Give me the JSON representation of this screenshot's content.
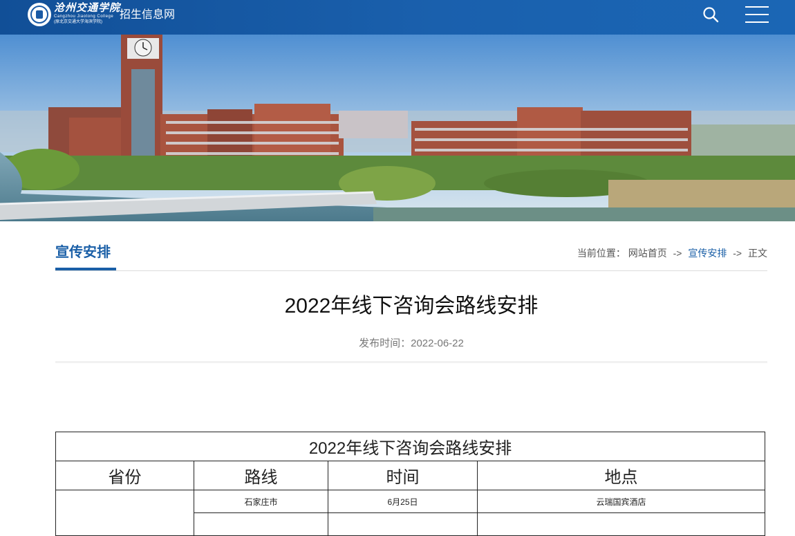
{
  "header": {
    "logo_cn": "沧州交通学院",
    "logo_en": "Cangzhou Jiaotong College",
    "logo_sub": "(原北京交通大学海滨学院)",
    "site_name": "招生信息网"
  },
  "section": {
    "title": "宣传安排"
  },
  "breadcrumb": {
    "prefix": "当前位置：",
    "home": "网站首页",
    "separator": "->",
    "category": "宣传安排",
    "current": "正文"
  },
  "article": {
    "title": "2022年线下咨询会路线安排",
    "publish_label": "发布时间：2022-06-22"
  },
  "table": {
    "caption": "2022年线下咨询会路线安排",
    "headers": [
      "省份",
      "路线",
      "时间",
      "地点"
    ],
    "rows": [
      {
        "province": "",
        "route": "石家庄市",
        "time": "6月25日",
        "place": "云瑞国宾酒店"
      }
    ]
  },
  "colors": {
    "header_bg": "#1a5aa5",
    "accent": "#1a5fa7",
    "text": "#333333"
  },
  "icons": {
    "search": "search-icon",
    "menu": "hamburger-menu-icon",
    "logo": "college-seal-icon"
  }
}
